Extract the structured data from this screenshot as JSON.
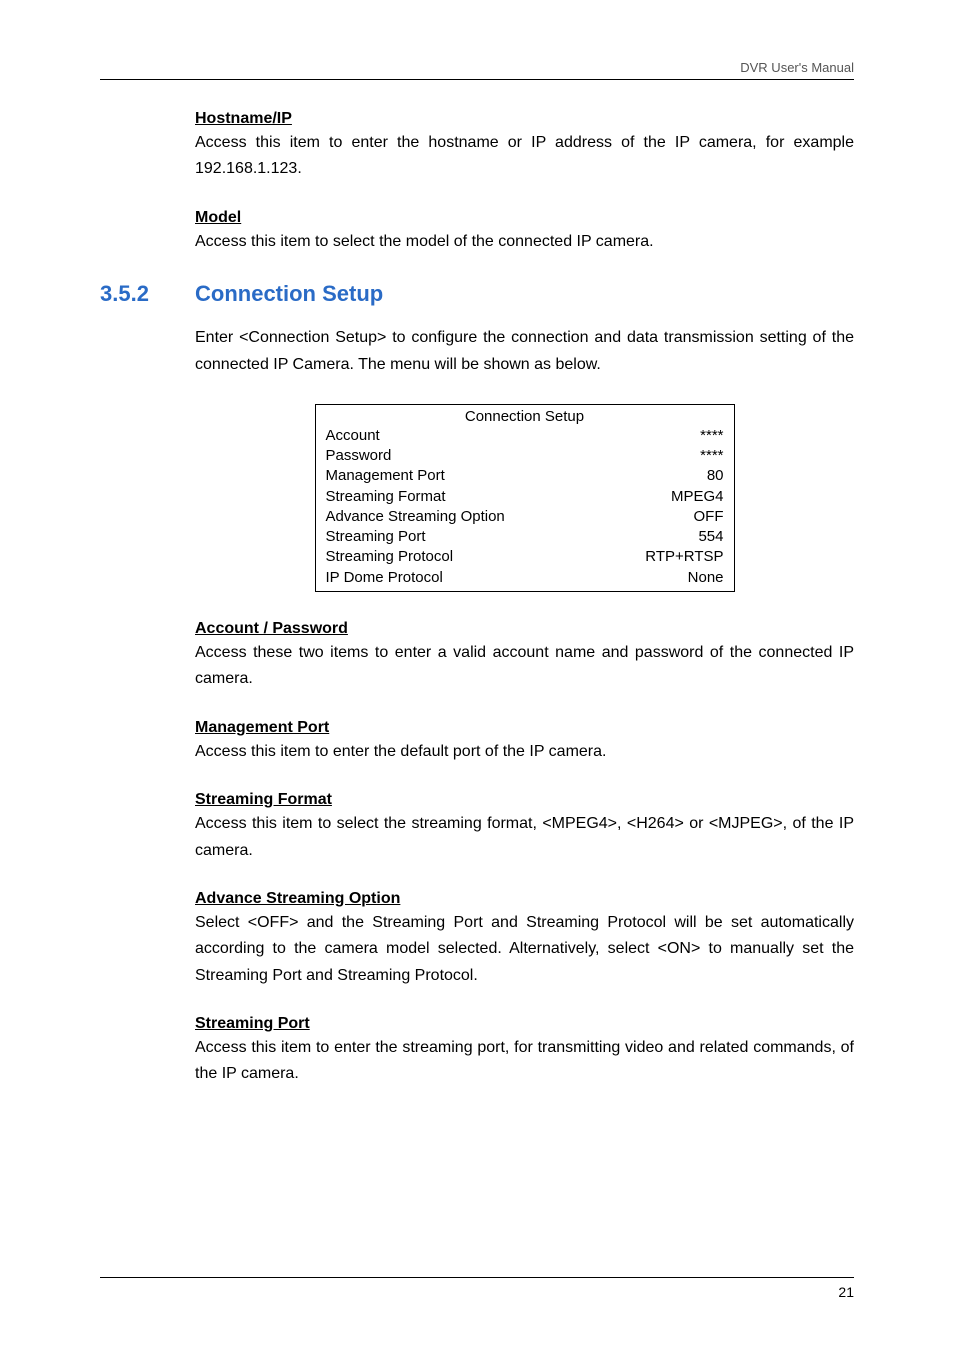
{
  "header": {
    "right": "DVR User's Manual"
  },
  "sections": {
    "hostname": {
      "title": "Hostname/IP",
      "body": "Access this item to enter the hostname or IP address of the IP camera, for example 192.168.1.123."
    },
    "model": {
      "title": "Model",
      "body": "Access this item to select the model of the connected IP camera."
    },
    "mainSection": {
      "num": "3.5.2",
      "title": "Connection Setup",
      "intro": "Enter <Connection Setup> to configure the connection and data transmission setting of the connected IP Camera. The menu will be shown as below."
    },
    "table": {
      "title": "Connection Setup",
      "rows": [
        {
          "label": "Account",
          "value": "****"
        },
        {
          "label": "Password",
          "value": "****"
        },
        {
          "label": "Management Port",
          "value": "80"
        },
        {
          "label": "Streaming Format",
          "value": "MPEG4"
        },
        {
          "label": "Advance Streaming Option",
          "value": "OFF"
        },
        {
          "label": "Streaming Port",
          "value": "554"
        },
        {
          "label": "Streaming Protocol",
          "value": "RTP+RTSP"
        },
        {
          "label": "IP Dome Protocol",
          "value": "None"
        }
      ]
    },
    "account": {
      "title": "Account / Password",
      "body": "Access these two items to enter a valid account name and password of the connected IP camera."
    },
    "mgmtPort": {
      "title": "Management Port",
      "body": "Access this item to enter the default port of the IP camera."
    },
    "streamFmt": {
      "title": "Streaming Format",
      "body": "Access this item to select the streaming format, <MPEG4>, <H264> or <MJPEG>, of the IP camera."
    },
    "advOpt": {
      "title": "Advance Streaming Option",
      "body": "Select <OFF> and the Streaming Port and Streaming Protocol will be set automatically according to the camera model selected. Alternatively, select <ON> to manually set the Streaming Port and Streaming Protocol."
    },
    "streamPort": {
      "title": "Streaming Port",
      "body": "Access this item to enter the streaming port, for transmitting video and related commands, of the IP camera."
    }
  },
  "footer": {
    "pageNum": "21"
  }
}
